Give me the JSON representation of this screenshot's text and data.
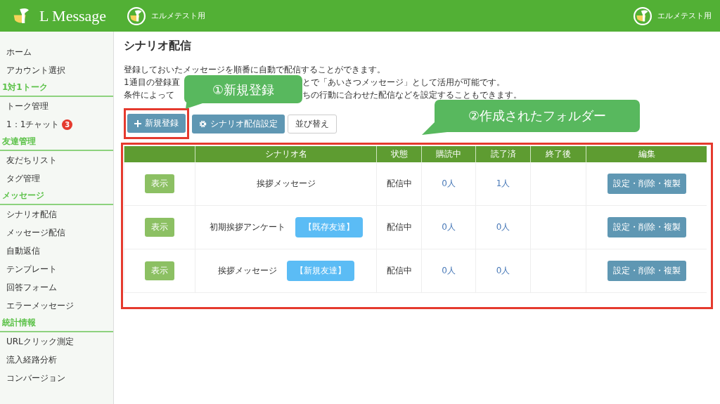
{
  "header": {
    "logo_text": "L Message",
    "account": "エルメテスト用",
    "user": "エルメテスト用"
  },
  "sidebar": {
    "items": [
      {
        "label": "ホーム"
      },
      {
        "label": "アカウント選択"
      }
    ],
    "sections": [
      {
        "title": "1対1トーク",
        "items": [
          {
            "label": "トーク管理"
          },
          {
            "label": "1：1チャット",
            "badge": "3"
          }
        ]
      },
      {
        "title": "友達管理",
        "items": [
          {
            "label": "友だちリスト"
          },
          {
            "label": "タグ管理"
          }
        ]
      },
      {
        "title": "メッセージ",
        "items": [
          {
            "label": "シナリオ配信"
          },
          {
            "label": "メッセージ配信"
          },
          {
            "label": "自動返信"
          },
          {
            "label": "テンプレート"
          },
          {
            "label": "回答フォーム"
          },
          {
            "label": "エラーメッセージ"
          }
        ]
      },
      {
        "title": "統計情報",
        "items": [
          {
            "label": "URLクリック測定"
          },
          {
            "label": "流入経路分析"
          },
          {
            "label": "コンバージョン"
          }
        ]
      }
    ]
  },
  "page": {
    "title": "シナリオ配信",
    "description": [
      [
        "登録しておいたメッセージを順番に自動で配信することができます。"
      ],
      [
        "1通目の登録直",
        "とで「あいさつメッセージ」として活用が可能です。"
      ],
      [
        "条件によって",
        "ちの行動に合わせた配信などを設定することもできます。"
      ]
    ],
    "buttons": [
      {
        "kind": "new",
        "label": "新規登録"
      },
      {
        "kind": "settings",
        "label": "シナリオ配信設定"
      },
      {
        "kind": "plain",
        "label": "並び替え"
      }
    ]
  },
  "callouts": [
    {
      "text": "①新規登録"
    },
    {
      "text": "②作成されたフォルダー"
    }
  ],
  "table": {
    "columns": [
      "",
      "シナリオ名",
      "状態",
      "購読中",
      "読了済",
      "終了後",
      "編集"
    ],
    "rows": [
      {
        "show": "表示",
        "name": "挨拶メッセージ",
        "status": "配信中",
        "subscribing": "0人",
        "read": "1人",
        "edit": "設定・削除・複製"
      },
      {
        "show": "表示",
        "name": "初期挨拶アンケート",
        "tag": "【既存友達】",
        "status": "配信中",
        "subscribing": "0人",
        "read": "0人",
        "edit": "設定・削除・複製"
      },
      {
        "show": "表示",
        "name": "挨拶メッセージ",
        "tag": "【新規友達】",
        "status": "配信中",
        "subscribing": "0人",
        "read": "0人",
        "edit": "設定・削除・複製"
      }
    ]
  }
}
